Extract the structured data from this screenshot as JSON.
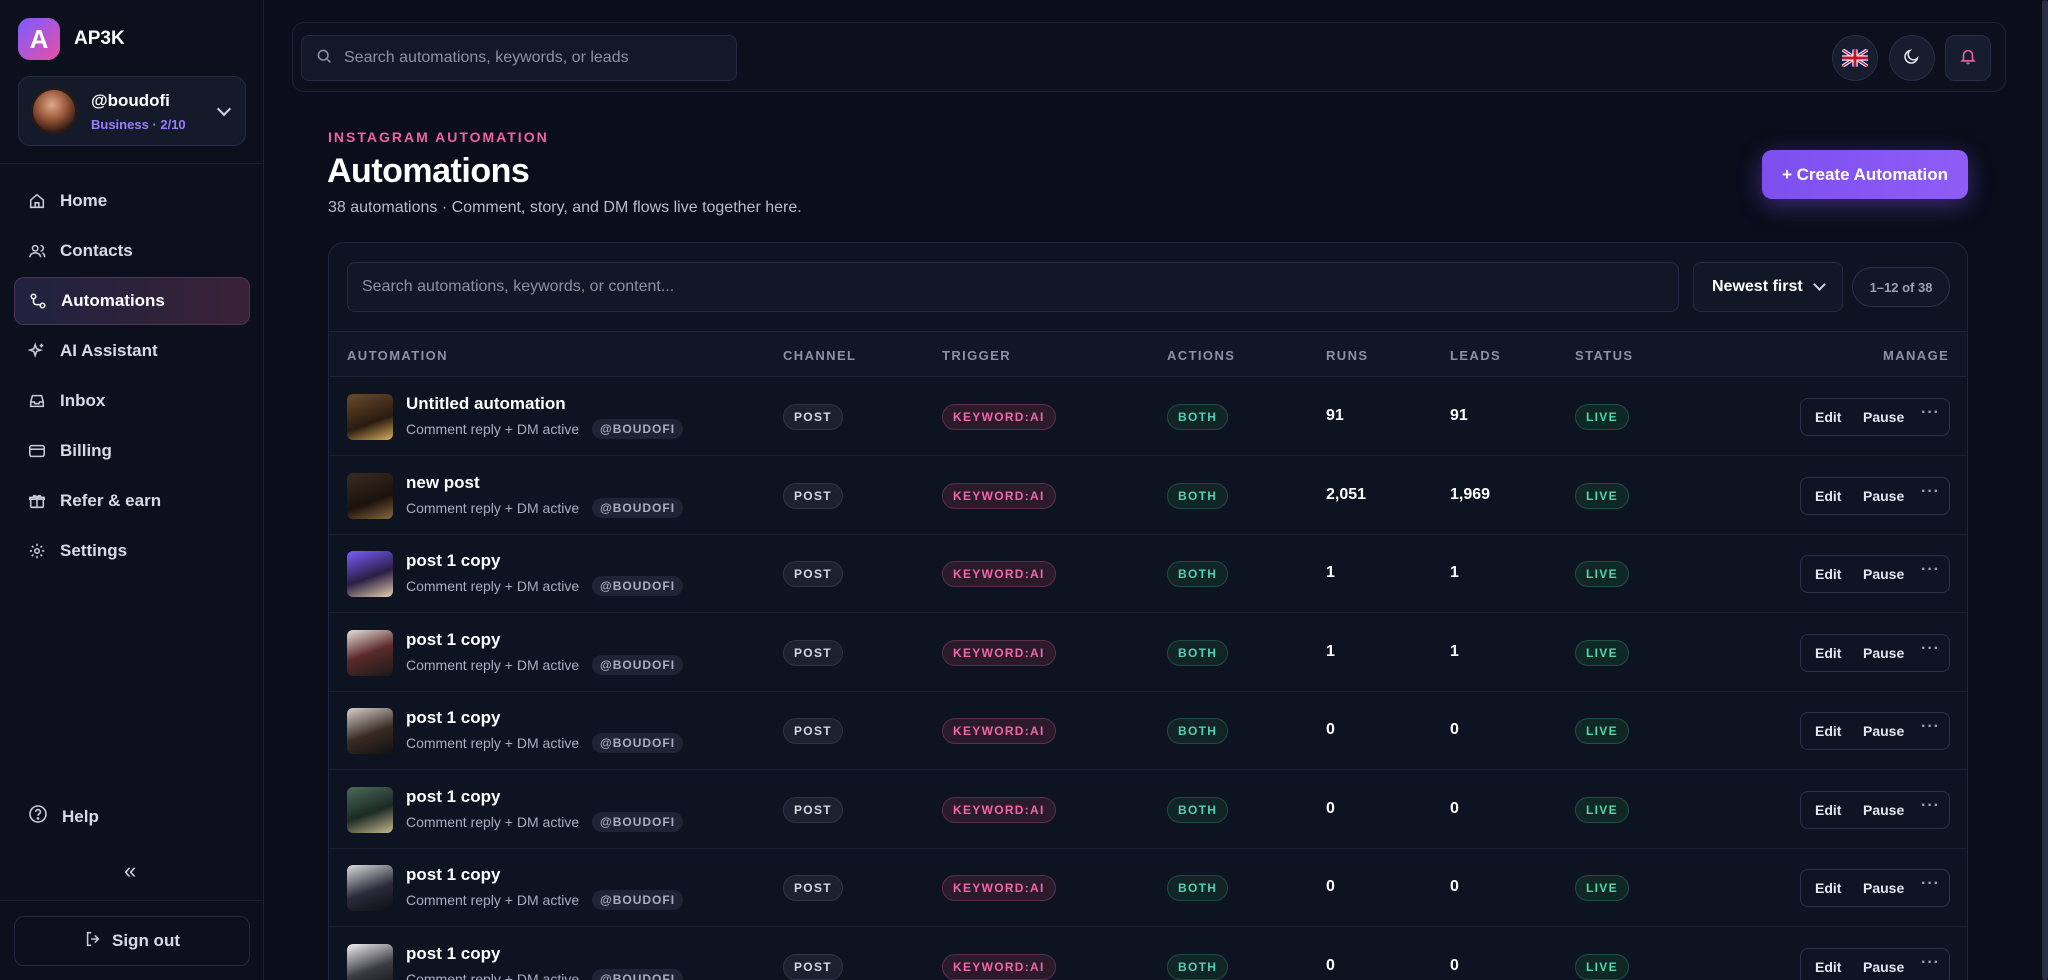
{
  "brand": {
    "logo_letter": "A",
    "name": "AP3K"
  },
  "account": {
    "handle": "@boudofi",
    "plan": "Business · 2/10"
  },
  "nav": [
    {
      "label": "Home",
      "icon": "home-icon"
    },
    {
      "label": "Contacts",
      "icon": "contacts-icon"
    },
    {
      "label": "Automations",
      "icon": "automations-icon",
      "active": true
    },
    {
      "label": "AI Assistant",
      "icon": "sparkle-icon"
    },
    {
      "label": "Inbox",
      "icon": "inbox-icon"
    },
    {
      "label": "Billing",
      "icon": "billing-icon"
    },
    {
      "label": "Refer & earn",
      "icon": "gift-icon"
    },
    {
      "label": "Settings",
      "icon": "gear-icon"
    }
  ],
  "help_label": "Help",
  "collapse_glyph": "«",
  "signout_label": "Sign out",
  "topbar": {
    "search_placeholder": "Search automations, keywords, or leads"
  },
  "header": {
    "eyebrow": "INSTAGRAM AUTOMATION",
    "title": "Automations",
    "subtitle": "38 automations · Comment, story, and DM flows live together here.",
    "create_label": "+ Create Automation"
  },
  "list": {
    "search_placeholder": "Search automations, keywords, or content...",
    "sort_label": "Newest first",
    "range_label": "1–12 of 38",
    "columns": [
      "AUTOMATION",
      "CHANNEL",
      "TRIGGER",
      "ACTIONS",
      "RUNS",
      "LEADS",
      "STATUS",
      "MANAGE"
    ],
    "rows": [
      {
        "name": "Untitled automation",
        "desc": "Comment reply + DM active",
        "handle": "@BOUDOFI",
        "channel": "POST",
        "trigger": "KEYWORD:AI",
        "actions": "BOTH",
        "runs": "91",
        "leads": "91",
        "status": "LIVE"
      },
      {
        "name": "new post",
        "desc": "Comment reply + DM active",
        "handle": "@BOUDOFI",
        "channel": "POST",
        "trigger": "KEYWORD:AI",
        "actions": "BOTH",
        "runs": "2,051",
        "leads": "1,969",
        "status": "LIVE"
      },
      {
        "name": "post 1 copy",
        "desc": "Comment reply + DM active",
        "handle": "@BOUDOFI",
        "channel": "POST",
        "trigger": "KEYWORD:AI",
        "actions": "BOTH",
        "runs": "1",
        "leads": "1",
        "status": "LIVE"
      },
      {
        "name": "post 1 copy",
        "desc": "Comment reply + DM active",
        "handle": "@BOUDOFI",
        "channel": "POST",
        "trigger": "KEYWORD:AI",
        "actions": "BOTH",
        "runs": "1",
        "leads": "1",
        "status": "LIVE"
      },
      {
        "name": "post 1 copy",
        "desc": "Comment reply + DM active",
        "handle": "@BOUDOFI",
        "channel": "POST",
        "trigger": "KEYWORD:AI",
        "actions": "BOTH",
        "runs": "0",
        "leads": "0",
        "status": "LIVE"
      },
      {
        "name": "post 1 copy",
        "desc": "Comment reply + DM active",
        "handle": "@BOUDOFI",
        "channel": "POST",
        "trigger": "KEYWORD:AI",
        "actions": "BOTH",
        "runs": "0",
        "leads": "0",
        "status": "LIVE"
      },
      {
        "name": "post 1 copy",
        "desc": "Comment reply + DM active",
        "handle": "@BOUDOFI",
        "channel": "POST",
        "trigger": "KEYWORD:AI",
        "actions": "BOTH",
        "runs": "0",
        "leads": "0",
        "status": "LIVE"
      },
      {
        "name": "post 1 copy",
        "desc": "Comment reply + DM active",
        "handle": "@BOUDOFI",
        "channel": "POST",
        "trigger": "KEYWORD:AI",
        "actions": "BOTH",
        "runs": "0",
        "leads": "0",
        "status": "LIVE"
      }
    ],
    "manage_labels": {
      "edit": "Edit",
      "pause": "Pause",
      "more": "···"
    }
  },
  "colors": {
    "accent": "#8f5cf7",
    "pink": "#f062a4",
    "live": "#4fd8a8",
    "background": "#0a0d1a"
  }
}
